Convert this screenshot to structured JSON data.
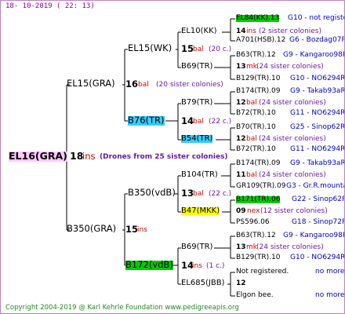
{
  "date": "18- 10-2019 (  22:  13)",
  "copyright": "Copyright 2004-2019 @ Karl Kehrle Foundation    www.pedigreeapis.org",
  "root": {
    "name": "EL16(GRA)",
    "num": "18",
    "unit": "ins",
    "note": "(Drones from 25 sister colonies)"
  },
  "gen1": {
    "upper": {
      "name": "EL15(GRA)",
      "num": "16",
      "unit": "bal",
      "note": "(20 sister colonies)"
    },
    "lower": {
      "name": "B350(GRA)",
      "num": "15",
      "unit": "ins"
    }
  },
  "gen2": {
    "a": {
      "name": "EL15(WK)",
      "num": "15",
      "unit": "bal",
      "note": "(20 c.)"
    },
    "b": {
      "name": "B76(TR)",
      "num": "14",
      "unit": "bal",
      "note": "(22 c.)"
    },
    "c": {
      "name": "B350(vdB)",
      "num": "13",
      "unit": "bal",
      "note": "(22 c.)"
    },
    "d": {
      "name": "B172(vdB)",
      "num": "14",
      "unit": "ins",
      "note": "(1 c.)"
    }
  },
  "gen3": [
    {
      "name": "EL10(KK)",
      "num": "14",
      "unit": "ins",
      "note": "(2 sister colonies)"
    },
    {
      "name": "B69(TR)",
      "num": "13",
      "unit": "mk",
      "note": "(24 sister colonies)"
    },
    {
      "name": "B79(TR)",
      "num": "12",
      "unit": "bal",
      "note": "(24 sister colonies)"
    },
    {
      "name": "B54(TR)",
      "num": "12",
      "unit": "bal",
      "note": "(24 sister colonies)"
    },
    {
      "name": "B104(TR)",
      "num": "11",
      "unit": "bal",
      "note": "(24 sister colonies)"
    },
    {
      "name": "B47(MKK)",
      "num": "09",
      "unit": "nex",
      "note": "(12 sister colonies)"
    },
    {
      "name": "B69(TR)",
      "num": "13",
      "unit": "mk",
      "note": "(24 sister colonies)"
    },
    {
      "name": "EL685(JBB)",
      "num": "12",
      "unit": "",
      "note": ""
    }
  ],
  "gen4": [
    {
      "name": "EL84(KK).13",
      "ref": "G10 - not registe"
    },
    {
      "name": "A701(HSB).12",
      "ref": "G6 - Bozdag07R"
    },
    {
      "name": "B63(TR).12",
      "ref": "G9 - Kangaroo98R"
    },
    {
      "name": "B129(TR).10",
      "ref": "G10 - NO6294R"
    },
    {
      "name": "B174(TR).09",
      "ref": "G9 - Takab93aR"
    },
    {
      "name": "B72(TR).10",
      "ref": "G11 - NO6294R"
    },
    {
      "name": "B70(TR).10",
      "ref": "G25 - Sinop62R"
    },
    {
      "name": "B72(TR).10",
      "ref": "G11 - NO6294R"
    },
    {
      "name": "B174(TR).09",
      "ref": "G9 - Takab93aR"
    },
    {
      "name": "GR109(TR).09",
      "ref": "G3 - Gr.R.mounta"
    },
    {
      "name": "B171(TR).06",
      "ref": "G22 - Sinop62R"
    },
    {
      "name": "PS596.06",
      "ref": "G18 - Sinop72R"
    },
    {
      "name": "B63(TR).12",
      "ref": "G9 - Kangaroo98R"
    },
    {
      "name": "B129(TR).10",
      "ref": "G10 - NO6294R"
    },
    {
      "name": "Not registered.",
      "ref": "no more"
    },
    {
      "name": "Elgon bee.",
      "ref": "no more"
    }
  ]
}
